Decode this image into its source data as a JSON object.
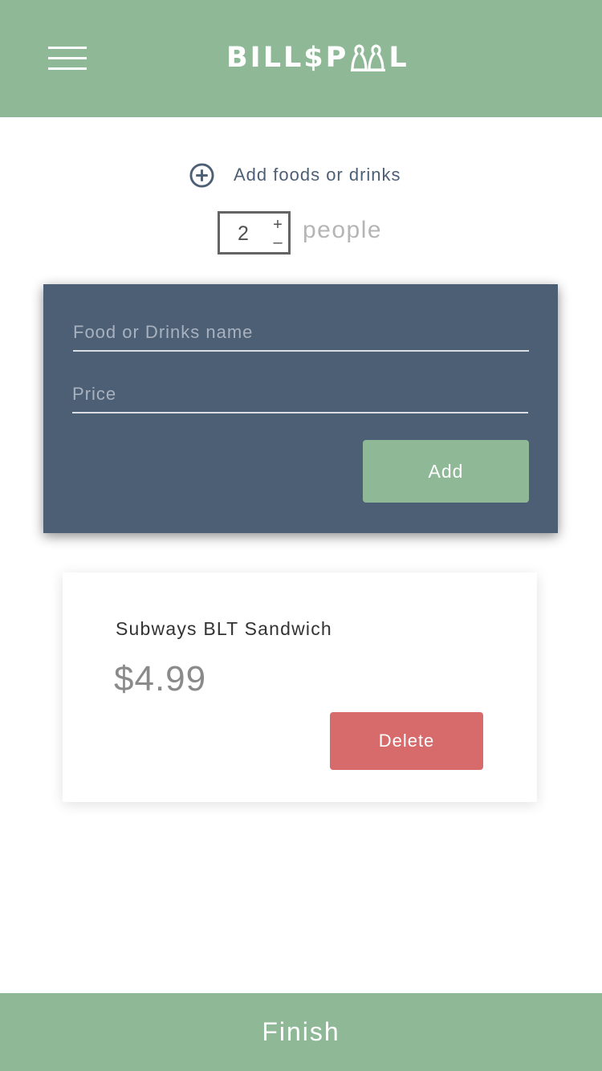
{
  "header": {
    "logo_prefix": "BILL$P",
    "logo_suffix": "L",
    "menu_icon": "hamburger-menu-icon",
    "logo_icon": "people-pair-icon"
  },
  "add_section": {
    "label": "Add foods or drinks",
    "icon": "plus-circle-icon"
  },
  "people": {
    "count": "2",
    "increment_symbol": "+",
    "decrement_symbol": "–",
    "label": "people"
  },
  "form": {
    "name_placeholder": "Food or Drinks name",
    "name_value": "",
    "price_placeholder": "Price",
    "price_value": "",
    "add_label": "Add"
  },
  "items": [
    {
      "name": "Subways BLT Sandwich",
      "price": "$4.99",
      "delete_label": "Delete"
    }
  ],
  "footer": {
    "finish_label": "Finish"
  },
  "colors": {
    "brand_green": "#8fb996",
    "slate": "#4d5f75",
    "delete_red": "#d76a6b"
  }
}
